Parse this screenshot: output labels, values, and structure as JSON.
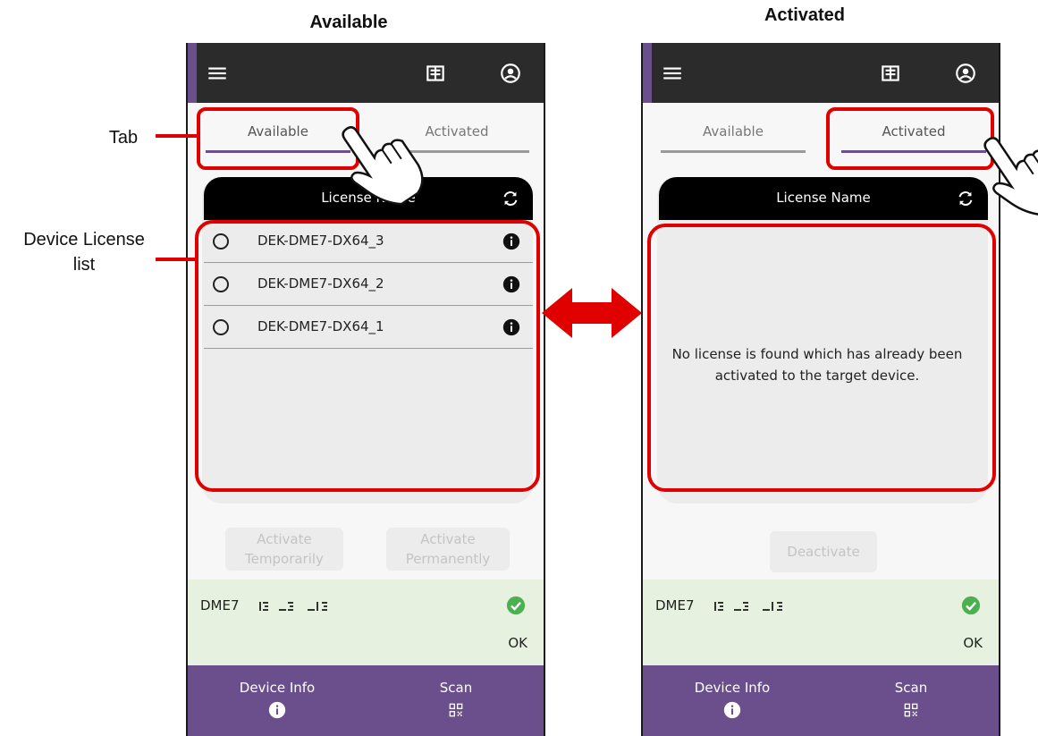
{
  "headings": {
    "left": "Available",
    "right": "Activated"
  },
  "callouts": {
    "tab": "Tab",
    "list_line1": "Device License",
    "list_line2": "list"
  },
  "icons": {
    "menu": "menu-icon",
    "tablet": "tablet-icon",
    "account": "account-circle-icon",
    "refresh": "refresh-icon",
    "info": "info-icon",
    "check": "check-circle-icon",
    "qr": "qr-code-icon",
    "pointer": "hand-pointer-icon",
    "arrow": "double-arrow-icon"
  },
  "colors": {
    "accent": "#6a4f8c",
    "appbar": "#2b2b2b",
    "status_bg": "#e6f2df",
    "highlight": "#e00000",
    "ok": "#4caf50"
  },
  "left_screen": {
    "tabs": [
      {
        "label": "Available",
        "active": true
      },
      {
        "label": "Activated",
        "active": false
      }
    ],
    "list_header": "License Name",
    "licenses": [
      "DEK-DME7-DX64_3",
      "DEK-DME7-DX64_2",
      "DEK-DME7-DX64_1"
    ],
    "buttons": {
      "temp_1": "Activate",
      "temp_2": "Temporarily",
      "perm_1": "Activate",
      "perm_2": "Permanently"
    },
    "status": {
      "device": "DME7",
      "ok": "OK"
    },
    "nav": {
      "device_info": "Device Info",
      "scan": "Scan"
    }
  },
  "right_screen": {
    "tabs": [
      {
        "label": "Available",
        "active": false
      },
      {
        "label": "Activated",
        "active": true
      }
    ],
    "list_header": "License Name",
    "empty_line1": "No license is found which has already been",
    "empty_line2": "activated to the target device.",
    "buttons": {
      "deactivate": "Deactivate"
    },
    "status": {
      "device": "DME7",
      "ok": "OK"
    },
    "nav": {
      "device_info": "Device Info",
      "scan": "Scan"
    }
  }
}
